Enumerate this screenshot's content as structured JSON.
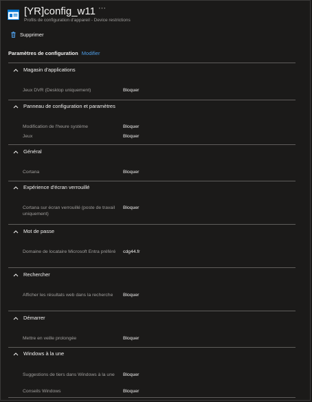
{
  "header": {
    "title": "[YR]config_w11",
    "more": "···",
    "subtitle": "Profils de configuration d'appareil - Device restrictions"
  },
  "toolbar": {
    "delete_label": "Supprimer"
  },
  "section": {
    "title": "Paramètres de configuration",
    "edit_link": "Modifier"
  },
  "groups": [
    {
      "title": "Magasin d'applications",
      "settings": [
        {
          "label": "Jeux DVR (Desktop uniquement)",
          "value": "Bloquer"
        }
      ]
    },
    {
      "title": "Panneau de configuration et paramètres",
      "settings": [
        {
          "label": "Modification de l'heure système",
          "value": "Bloquer"
        },
        {
          "label": "Jeux",
          "value": "Bloquer"
        }
      ]
    },
    {
      "title": "Général",
      "settings": [
        {
          "label": "Cortana",
          "value": "Bloquer"
        }
      ]
    },
    {
      "title": "Expérience d'écran verrouillé",
      "settings": [
        {
          "label": "Cortana sur écran verrouillé (poste de travail uniquement)",
          "value": "Bloquer"
        }
      ]
    },
    {
      "title": "Mot de passe",
      "settings": [
        {
          "label": "Domaine de locataire Microsoft Entra préféré",
          "value": "cdg44.fr"
        }
      ]
    },
    {
      "title": "Rechercher",
      "settings": [
        {
          "label": "Afficher les résultats web dans la recherche",
          "value": "Bloquer"
        }
      ]
    },
    {
      "title": "Démarrer",
      "settings": [
        {
          "label": "Mettre en veille prolongée",
          "value": "Bloquer"
        }
      ]
    },
    {
      "title": "Windows à la une",
      "settings": [
        {
          "label": "Suggestions de tiers dans Windows à la une",
          "value": "Bloquer"
        },
        {
          "label": "Conseils Windows",
          "value": "Bloquer"
        }
      ]
    }
  ]
}
